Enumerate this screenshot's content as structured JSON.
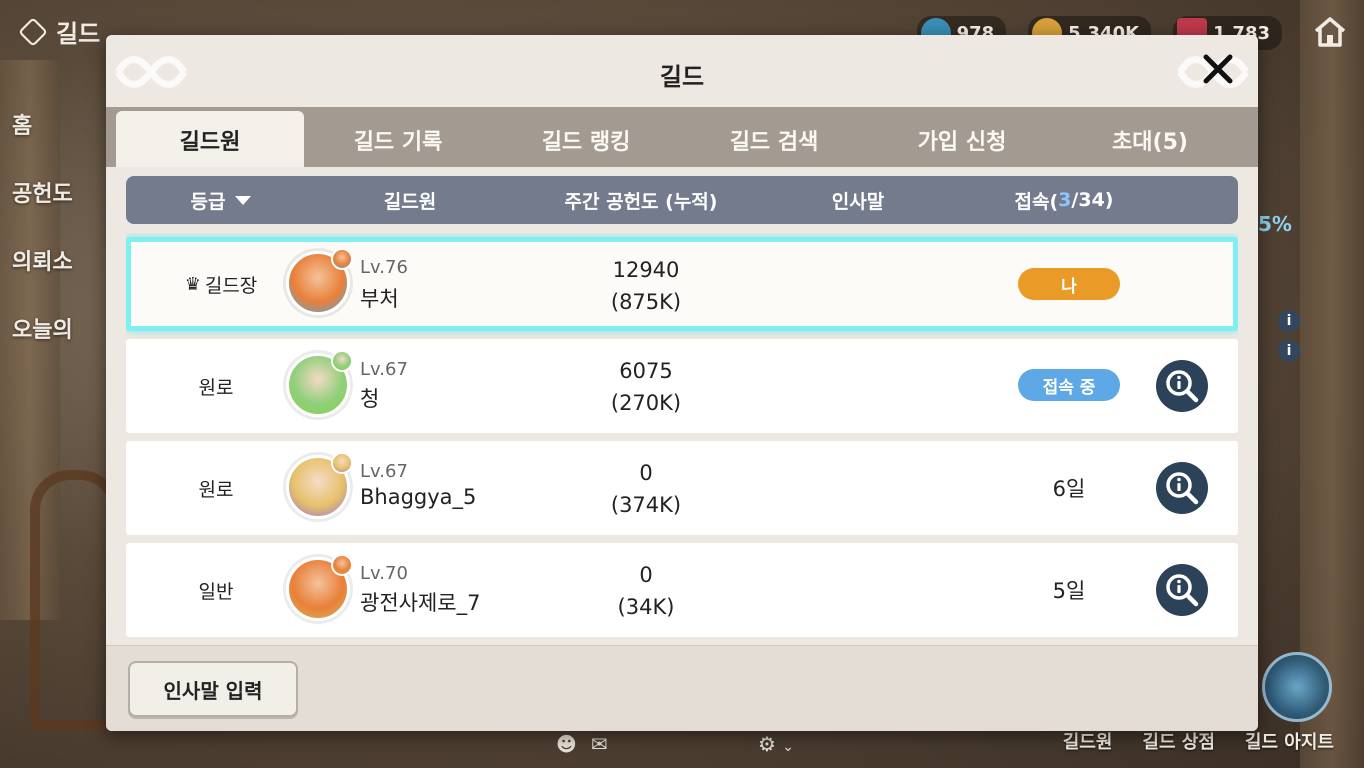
{
  "hud": {
    "top_left_label": "길드",
    "left_menu": [
      "홈",
      "공헌도",
      "의뢰소",
      "오늘의"
    ],
    "currencies": [
      {
        "icon": "gem-icon",
        "value": "978",
        "color": "#3a8fb7"
      },
      {
        "icon": "gold-coin-icon",
        "value": "5,340K",
        "color": "#d9a13a"
      },
      {
        "icon": "ticket-icon",
        "value": "1,783",
        "color": "#c0394b"
      }
    ],
    "side_percent": "5%",
    "bottom_links": [
      "길드원",
      "길드 상점",
      "길드 아지트"
    ]
  },
  "modal": {
    "title": "길드",
    "tabs": [
      {
        "label": "길드원",
        "active": true
      },
      {
        "label": "길드 기록",
        "active": false
      },
      {
        "label": "길드 랭킹",
        "active": false
      },
      {
        "label": "길드 검색",
        "active": false
      },
      {
        "label": "가입 신청",
        "active": false
      },
      {
        "label": "초대(5)",
        "active": false
      }
    ],
    "columns": {
      "grade": "등급",
      "member": "길드원",
      "contribution": "주간 공헌도 (누적)",
      "greeting": "인사말",
      "online_prefix": "접속(",
      "online_count": "3",
      "online_suffix": "/34)"
    },
    "members": [
      {
        "grade": "길드장",
        "level": "Lv.76",
        "name": "부처",
        "weekly": "12940",
        "total": "(875K)",
        "status": "나",
        "status_type": "me",
        "avatar_color": "#e9803a",
        "ring_color": "#4aa9e0"
      },
      {
        "grade": "원로",
        "level": "Lv.67",
        "name": "청",
        "weekly": "6075",
        "total": "(270K)",
        "status": "접속 중",
        "status_type": "online",
        "avatar_color": "#8fcf7a",
        "ring_color": "#8ad24a"
      },
      {
        "grade": "원로",
        "level": "Lv.67",
        "name": "Bhaggya_5",
        "weekly": "0",
        "total": "(374K)",
        "status": "6일",
        "status_type": "offline",
        "avatar_color": "#e6c16a",
        "ring_color": "#9a6fd6"
      },
      {
        "grade": "일반",
        "level": "Lv.70",
        "name": "광전사제로_7",
        "weekly": "0",
        "total": "(34K)",
        "status": "5일",
        "status_type": "offline",
        "avatar_color": "#e9803a",
        "ring_color": "#d7b45a"
      }
    ],
    "footer_button": "인사말 입력",
    "colors": {
      "me_pill": "#ea9a26",
      "online_pill": "#5ea8e6",
      "header_bg": "#737b8d",
      "highlight_border": "#7ef0f2"
    }
  }
}
